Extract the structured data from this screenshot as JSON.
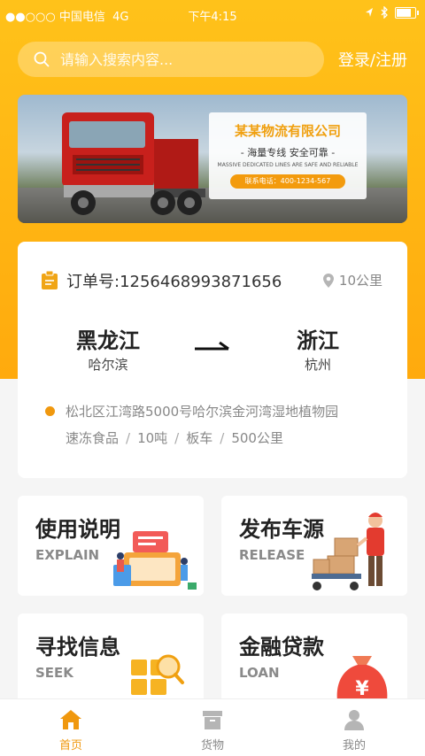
{
  "status_bar": {
    "carrier": "●●○○○ 中国电信",
    "network": "4G",
    "time": "下午4:15"
  },
  "header": {
    "search_placeholder": "请输入搜索内容...",
    "login_label": "登录/注册"
  },
  "banner": {
    "company": "某某物流有限公司",
    "slogan": "- 海量专线 安全可靠 -",
    "english": "MASSIVE DEDICATED LINES ARE SAFE AND RELIABLE",
    "phone": "联系电话：400-1234-567"
  },
  "order": {
    "number_label": "订单号:1256468993871656",
    "distance": "10公里",
    "from_province": "黑龙江",
    "from_city": "哈尔滨",
    "to_province": "浙江",
    "to_city": "杭州",
    "address": "松北区江湾路5000号哈尔滨金河湾湿地植物园",
    "tags": [
      "速冻食品",
      "10吨",
      "板车",
      "500公里"
    ]
  },
  "tiles": [
    {
      "title": "使用说明",
      "subtitle": "EXPLAIN"
    },
    {
      "title": "发布车源",
      "subtitle": "RELEASE"
    },
    {
      "title": "寻找信息",
      "subtitle": "SEEK"
    },
    {
      "title": "金融贷款",
      "subtitle": "LOAN"
    }
  ],
  "loan_symbol": "¥",
  "tabbar": {
    "items": [
      {
        "label": "首页"
      },
      {
        "label": "货物"
      },
      {
        "label": "我的"
      }
    ]
  },
  "colors": {
    "accent": "#f0980e",
    "header_bg": "#ffb812",
    "tab_active": "#f0980e"
  }
}
